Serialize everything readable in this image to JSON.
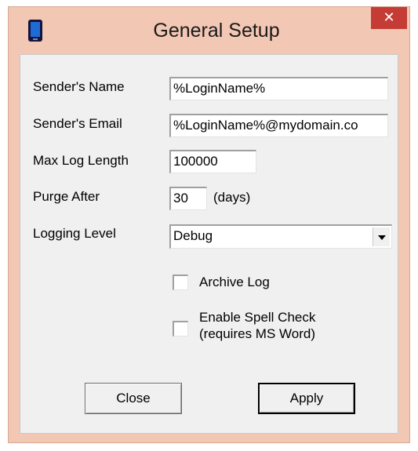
{
  "window": {
    "title": "General Setup",
    "close_glyph": "✕"
  },
  "form": {
    "sender_name": {
      "label": "Sender's Name",
      "value": "%LoginName%"
    },
    "sender_email": {
      "label": "Sender's Email",
      "value": "%LoginName%@mydomain.co"
    },
    "max_log_length": {
      "label": "Max Log Length",
      "value": "100000"
    },
    "purge_after": {
      "label": "Purge After",
      "value": "30",
      "unit": "(days)"
    },
    "logging_level": {
      "label": "Logging Level",
      "value": "Debug"
    },
    "archive_log": {
      "label": "Archive Log",
      "checked": false
    },
    "spell_check": {
      "label_line1": "Enable Spell Check",
      "label_line2": "(requires MS Word)",
      "checked": false
    }
  },
  "buttons": {
    "close_label": "Close",
    "apply_label": "Apply"
  },
  "icons": {
    "app": "phone-icon",
    "close": "close-icon",
    "dropdown": "chevron-down-icon"
  },
  "colors": {
    "titlebar_bg": "#f2c7b4",
    "close_bg": "#c43c35",
    "client_bg": "#f0f0f0"
  }
}
